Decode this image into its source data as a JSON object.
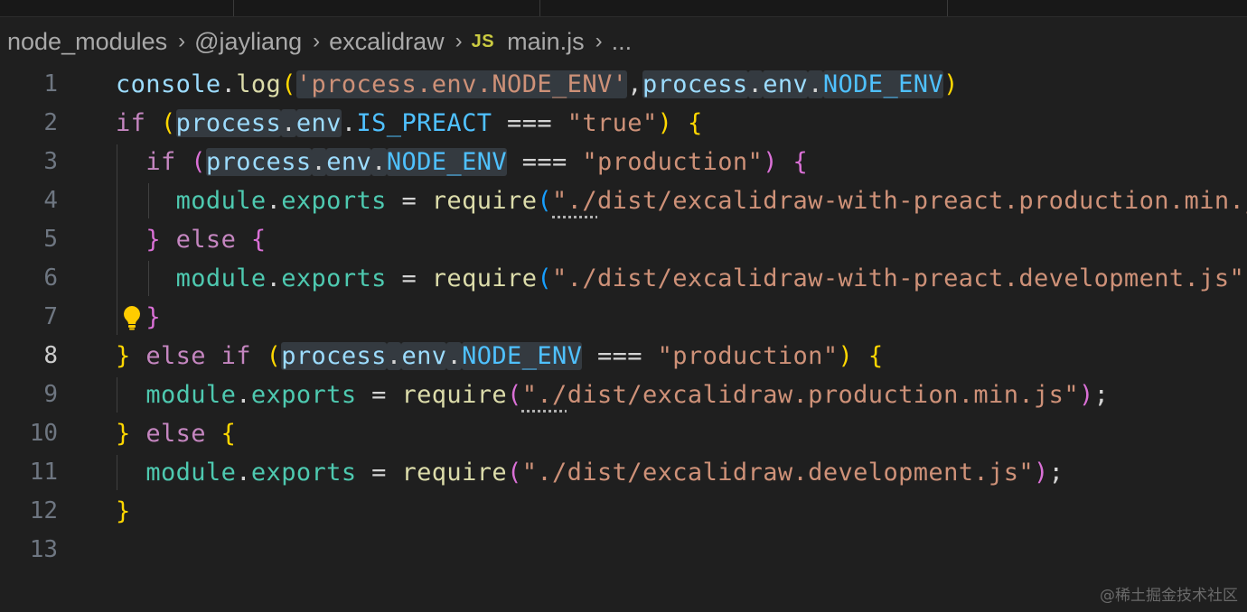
{
  "breadcrumb": {
    "segments": [
      "node_modules",
      "@jayliang",
      "excalidraw"
    ],
    "file_badge": "JS",
    "file_name": "main.js",
    "more": "..."
  },
  "editor": {
    "active_line": 8,
    "line_numbers": [
      "1",
      "2",
      "3",
      "4",
      "5",
      "6",
      "7",
      "8",
      "9",
      "10",
      "11",
      "12",
      "13"
    ],
    "lines": [
      [
        [
          "console",
          "var"
        ],
        [
          ".",
          "pun"
        ],
        [
          "log",
          "fn"
        ],
        [
          "(",
          "b1"
        ],
        [
          "'process.env.NODE_ENV'",
          "str hl"
        ],
        [
          ",",
          "pun"
        ],
        [
          "process",
          "var hl"
        ],
        [
          ".",
          "pun hl"
        ],
        [
          "env",
          "var hl"
        ],
        [
          ".",
          "pun hl"
        ],
        [
          "NODE_ENV",
          "const hl"
        ],
        [
          ")",
          "b1"
        ]
      ],
      [
        [
          "if",
          "kw"
        ],
        [
          " ",
          "pun"
        ],
        [
          "(",
          "b1"
        ],
        [
          "process",
          "var hl"
        ],
        [
          ".",
          "pun hl"
        ],
        [
          "env",
          "var hl"
        ],
        [
          ".",
          "pun"
        ],
        [
          "IS_PREACT",
          "const"
        ],
        [
          " === ",
          "op"
        ],
        [
          "\"true\"",
          "str"
        ],
        [
          ")",
          "b1"
        ],
        [
          " ",
          "pun"
        ],
        [
          "{",
          "b1"
        ]
      ],
      [
        [
          "  ",
          "pun"
        ],
        [
          "if",
          "kw"
        ],
        [
          " ",
          "pun"
        ],
        [
          "(",
          "b2"
        ],
        [
          "process",
          "var hl"
        ],
        [
          ".",
          "pun hl"
        ],
        [
          "env",
          "var hl"
        ],
        [
          ".",
          "pun hl"
        ],
        [
          "NODE_ENV",
          "const hl"
        ],
        [
          " === ",
          "op"
        ],
        [
          "\"production\"",
          "str"
        ],
        [
          ")",
          "b2"
        ],
        [
          " ",
          "pun"
        ],
        [
          "{",
          "b2"
        ]
      ],
      [
        [
          "    ",
          "pun"
        ],
        [
          "module",
          "prop"
        ],
        [
          ".",
          "pun"
        ],
        [
          "exports",
          "prop"
        ],
        [
          " = ",
          "op"
        ],
        [
          "require",
          "fn"
        ],
        [
          "(",
          "b3"
        ],
        [
          "\"./",
          "str sq"
        ],
        [
          "dist/excalidraw-with-preact.production.min.js\"",
          "str"
        ],
        [
          ")",
          "b3"
        ],
        [
          ";",
          "pun"
        ]
      ],
      [
        [
          "  ",
          "pun"
        ],
        [
          "}",
          "b2"
        ],
        [
          " ",
          "pun"
        ],
        [
          "else",
          "kw"
        ],
        [
          " ",
          "pun"
        ],
        [
          "{",
          "b2"
        ]
      ],
      [
        [
          "    ",
          "pun"
        ],
        [
          "module",
          "prop"
        ],
        [
          ".",
          "pun"
        ],
        [
          "exports",
          "prop"
        ],
        [
          " = ",
          "op"
        ],
        [
          "require",
          "fn"
        ],
        [
          "(",
          "b3"
        ],
        [
          "\"./dist/excalidraw-with-preact.development.js\"",
          "str"
        ],
        [
          ")",
          "b3"
        ],
        [
          ";",
          "pun"
        ]
      ],
      [
        [
          "  ",
          "pun"
        ],
        [
          "}",
          "b2"
        ]
      ],
      [
        [
          "}",
          "b1"
        ],
        [
          " ",
          "pun"
        ],
        [
          "else if",
          "kw"
        ],
        [
          " ",
          "pun"
        ],
        [
          "(",
          "b1"
        ],
        [
          "process",
          "var hl"
        ],
        [
          ".",
          "pun hl"
        ],
        [
          "env",
          "var hl"
        ],
        [
          ".",
          "pun hl"
        ],
        [
          "NODE_ENV",
          "const hl"
        ],
        [
          " === ",
          "op"
        ],
        [
          "\"production\"",
          "str"
        ],
        [
          ")",
          "b1"
        ],
        [
          " ",
          "pun"
        ],
        [
          "{",
          "b1"
        ]
      ],
      [
        [
          "  ",
          "pun"
        ],
        [
          "module",
          "prop"
        ],
        [
          ".",
          "pun"
        ],
        [
          "exports",
          "prop"
        ],
        [
          " = ",
          "op"
        ],
        [
          "require",
          "fn"
        ],
        [
          "(",
          "b2"
        ],
        [
          "\"./",
          "str sq"
        ],
        [
          "dist/excalidraw.production.min.js\"",
          "str"
        ],
        [
          ")",
          "b2"
        ],
        [
          ";",
          "pun"
        ]
      ],
      [
        [
          "}",
          "b1"
        ],
        [
          " ",
          "pun"
        ],
        [
          "else",
          "kw"
        ],
        [
          " ",
          "pun"
        ],
        [
          "{",
          "b1"
        ]
      ],
      [
        [
          "  ",
          "pun"
        ],
        [
          "module",
          "prop"
        ],
        [
          ".",
          "pun"
        ],
        [
          "exports",
          "prop"
        ],
        [
          " = ",
          "op"
        ],
        [
          "require",
          "fn"
        ],
        [
          "(",
          "b2"
        ],
        [
          "\"./dist/excalidraw.development.js\"",
          "str"
        ],
        [
          ")",
          "b2"
        ],
        [
          ";",
          "pun"
        ]
      ],
      [
        [
          "}",
          "b1"
        ]
      ],
      []
    ]
  },
  "lightbulb_line": 7,
  "watermark": "@稀土掘金技术社区",
  "colors": {
    "background": "#1f1f1f",
    "keyword": "#c586c0",
    "string": "#ce9178",
    "variable": "#9cdcfe",
    "constant": "#4fc1ff",
    "function": "#dcdcaa",
    "property": "#4ec9b0",
    "bracket1": "#ffd700",
    "bracket2": "#da70d6",
    "bracket3": "#179fff"
  }
}
